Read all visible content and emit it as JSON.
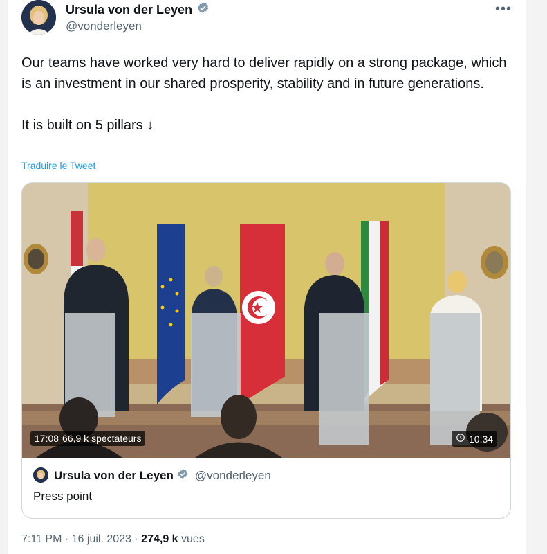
{
  "author": {
    "name": "Ursula von der Leyen",
    "handle": "@vonderleyen",
    "verified_icon": "verified-badge-icon"
  },
  "more_label": "•••",
  "tweet_text": {
    "line1": "Our teams have worked very hard to deliver rapidly on a strong package, which is an investment in our shared prosperity, stability and in future generations.",
    "line2": "It is built on 5 pillars ↓"
  },
  "translate_label": "Traduire le Tweet",
  "video": {
    "live_time": "17:08",
    "viewers": "66,9 k spectateurs",
    "duration": "10:34",
    "replay_icon": "replay-clock-icon"
  },
  "quote": {
    "name": "Ursula von der Leyen",
    "handle": "@vonderleyen",
    "text": "Press point"
  },
  "meta": {
    "time": "7:11 PM",
    "separator": "·",
    "date": "16 juil. 2023",
    "views_count": "274,9 k",
    "views_label": "vues"
  },
  "colors": {
    "link": "#1d9bf0",
    "secondary_text": "#536471",
    "verified": "#829aab"
  }
}
